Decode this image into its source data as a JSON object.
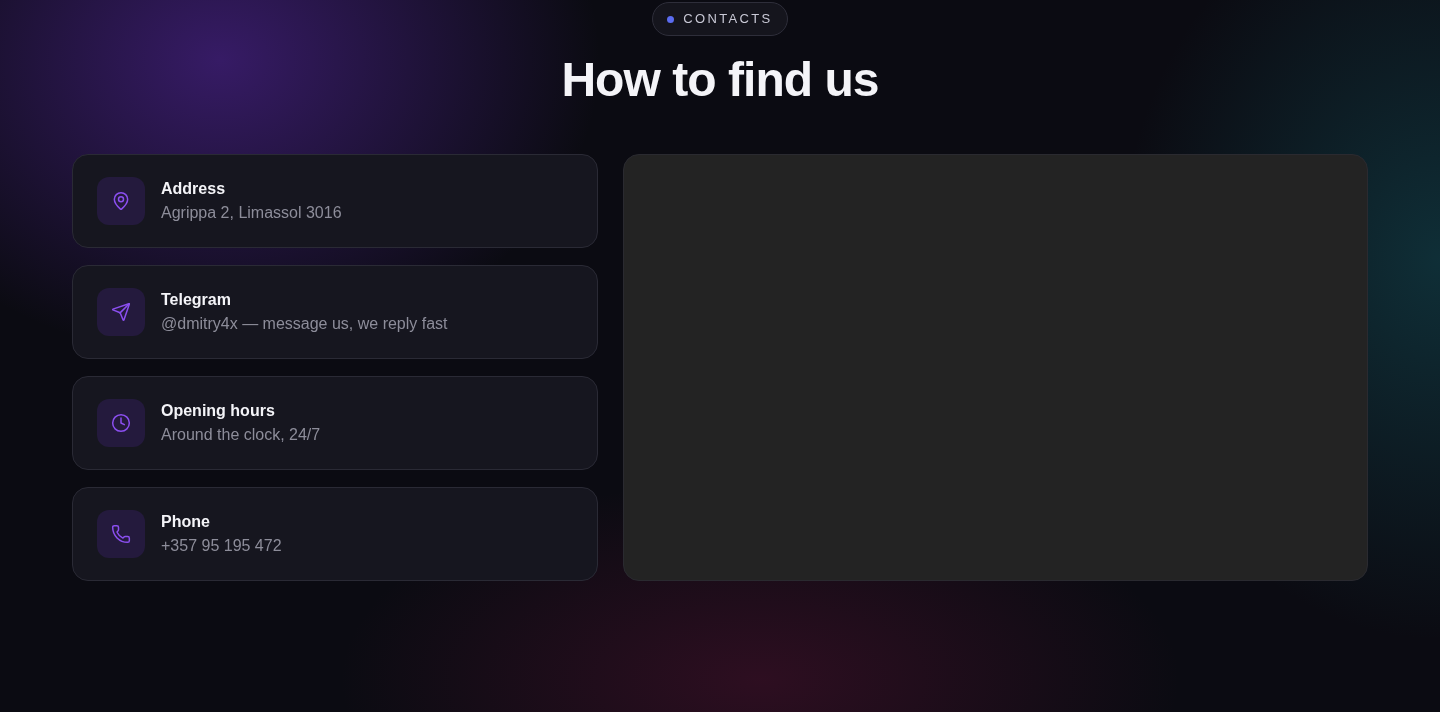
{
  "badge": {
    "label": "CONTACTS"
  },
  "title": "How to find us",
  "contacts": [
    {
      "kind": "address",
      "label": "Address",
      "value": "Agrippa 2, Limassol 3016"
    },
    {
      "kind": "telegram",
      "label": "Telegram",
      "value": "@dmitry4x — message us, we reply fast"
    },
    {
      "kind": "hours",
      "label": "Opening hours",
      "value": "Around the clock, 24/7"
    },
    {
      "kind": "phone",
      "label": "Phone",
      "value": "+357 95 195 472"
    }
  ],
  "map": {
    "kind": "empty"
  }
}
